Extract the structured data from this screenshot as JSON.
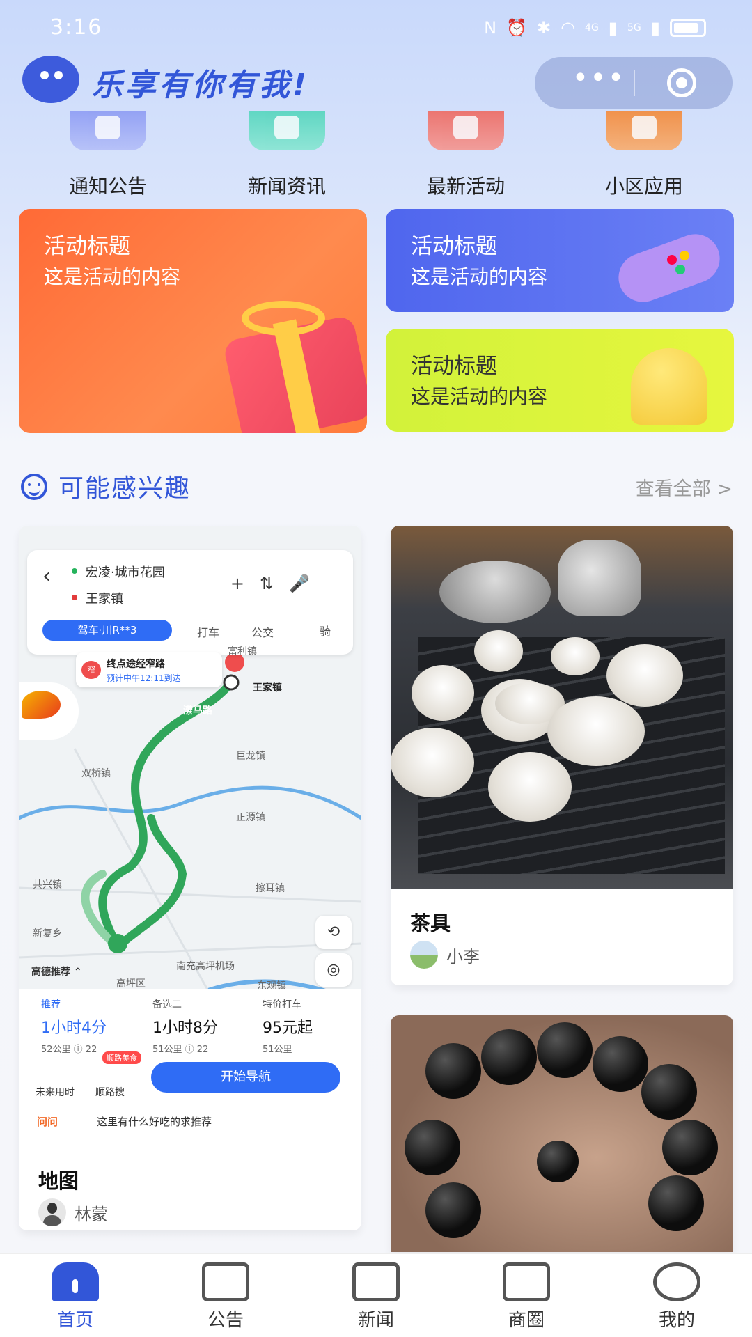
{
  "status_bar": {
    "time": "3:16",
    "signal1": "4G",
    "signal2": "5G"
  },
  "header": {
    "title": "乐享有你有我!",
    "menu_dots": "•••"
  },
  "categories": [
    {
      "label": "通知公告",
      "icon": "bell-icon"
    },
    {
      "label": "新闻资讯",
      "icon": "newspaper-icon"
    },
    {
      "label": "最新活动",
      "icon": "activity-icon"
    },
    {
      "label": "小区应用",
      "icon": "chat-apps-icon"
    }
  ],
  "banners": [
    {
      "title": "活动标题",
      "content": "这是活动的内容",
      "color": "#ff7a3d",
      "icon": "gift-icon"
    },
    {
      "title": "活动标题",
      "content": "这是活动的内容",
      "color": "#5a70f0",
      "icon": "gamepad-icon"
    },
    {
      "title": "活动标题",
      "content": "这是活动的内容",
      "color": "#d9f23c",
      "icon": "bell-3d-icon"
    }
  ],
  "interest": {
    "title": "可能感兴趣",
    "see_all": "查看全部 >"
  },
  "cards": [
    {
      "title": "地图",
      "author": "林蒙",
      "map": {
        "from": "宏凌·城市花园",
        "to": "王家镇",
        "mode_car": "驾车·川R**3",
        "mode_taxi": "打车",
        "mode_bus": "公交",
        "mode_more": "骑",
        "tip_title": "终点途经窄路",
        "tip_sub": "预计中午12:11到达",
        "tip_badge": "窄",
        "places": [
          "王家镇",
          "巨龙镇",
          "双桥镇",
          "正源镇",
          "共兴镇",
          "新复乡",
          "擦耳镇",
          "高坪区",
          "东观镇",
          "富利镇",
          "南充高坪机场",
          "潆马路"
        ],
        "gaode_label": "高德推荐 ⌃",
        "options": [
          {
            "key": "推荐",
            "value": "1小时4分",
            "sub": "52公里 ⓘ 22"
          },
          {
            "key": "备选二",
            "value": "1小时8分",
            "sub": "51公里 ⓘ 22"
          },
          {
            "key": "特价打车",
            "value": "95元起",
            "sub": "51公里"
          }
        ],
        "future": "未来用时",
        "along": "顺路搜",
        "along_tag": "顺路美食",
        "nav_button": "开始导航",
        "ask_label": "问问",
        "ask_text": "这里有什么好吃的求推荐"
      }
    },
    {
      "title": "茶具",
      "author": "小李"
    },
    {
      "title": "",
      "author": ""
    }
  ],
  "tabs": [
    {
      "label": "首页",
      "active": true,
      "icon": "home-icon"
    },
    {
      "label": "公告",
      "active": false,
      "icon": "megaphone-icon"
    },
    {
      "label": "新闻",
      "active": false,
      "icon": "news-icon"
    },
    {
      "label": "商圈",
      "active": false,
      "icon": "building-icon"
    },
    {
      "label": "我的",
      "active": false,
      "icon": "smile-chat-icon"
    }
  ],
  "colors": {
    "accent": "#3256d8",
    "nav_blue": "#2f6cf5"
  }
}
